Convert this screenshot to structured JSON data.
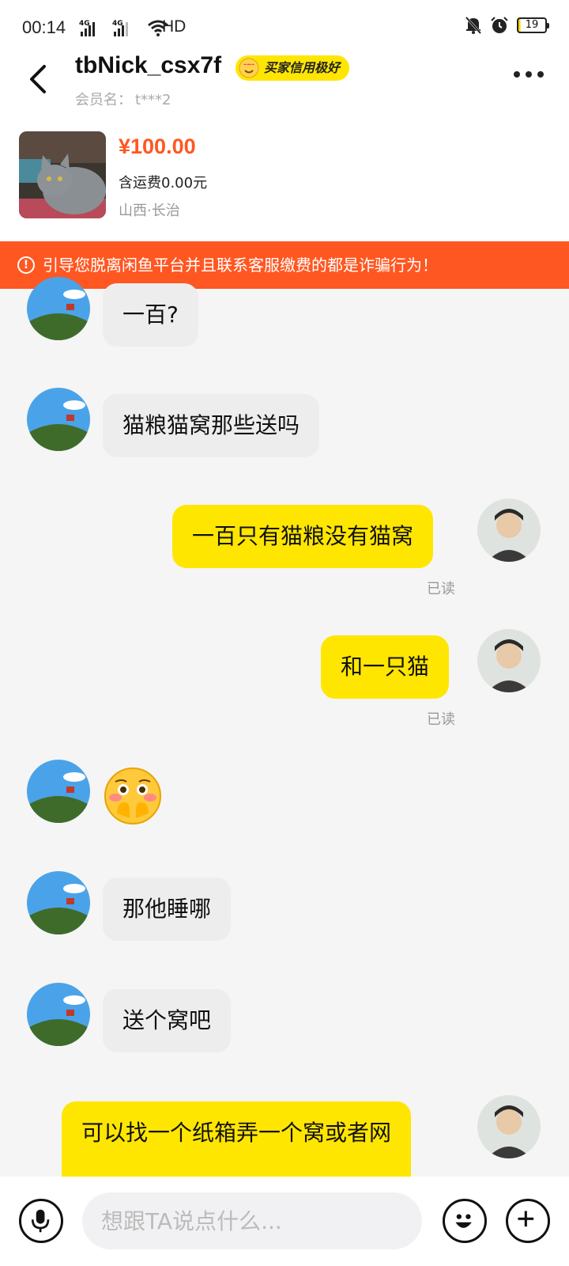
{
  "status_bar": {
    "time": "00:14",
    "sim1": "4G",
    "sim2": "4G",
    "hd": "HD",
    "battery": "19"
  },
  "header": {
    "nickname": "tbNick_csx7f",
    "credit_badge": "买家信用极好",
    "member_label": "会员名：",
    "member_name": "t***2"
  },
  "product": {
    "price": "¥100.00",
    "shipping": "含运费0.00元",
    "location": "山西·长治"
  },
  "warning": {
    "text": "引导您脱离闲鱼平台并且联系客服缴费的都是诈骗行为！",
    "color": "#ff5722"
  },
  "messages": [
    {
      "side": "left",
      "text": "一百?"
    },
    {
      "side": "left",
      "text": "猫粮猫窝那些送吗"
    },
    {
      "side": "right",
      "text": "一百只有猫粮没有猫窝",
      "status": "已读"
    },
    {
      "side": "right",
      "text": "和一只猫",
      "status": "已读"
    },
    {
      "side": "left",
      "emoji": "flushed-face-with-hands"
    },
    {
      "side": "left",
      "text": "那他睡哪"
    },
    {
      "side": "left",
      "text": "送个窝吧"
    },
    {
      "side": "right",
      "text": "可以找一个纸箱弄一个窝或者网"
    }
  ],
  "input": {
    "placeholder": "想跟TA说点什么..."
  },
  "colors": {
    "accent_yellow": "#ffe600",
    "price_orange": "#ff5722",
    "bubble_gray": "#ededee"
  }
}
